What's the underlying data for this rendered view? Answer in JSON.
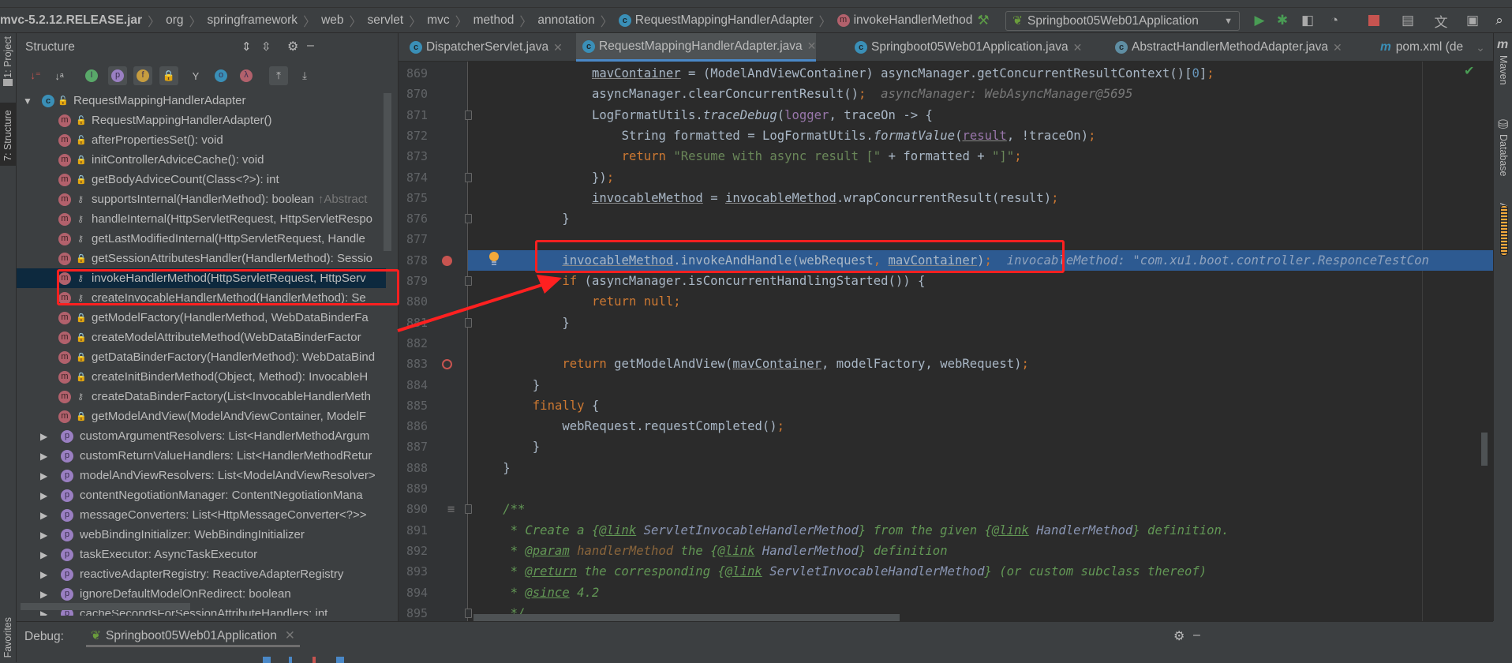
{
  "breadcrumb": {
    "items": [
      "mvc-5.2.12.RELEASE.jar",
      "org",
      "springframework",
      "web",
      "servlet",
      "mvc",
      "method",
      "annotation"
    ],
    "class_item": "RequestMappingHandlerAdapter",
    "method_item": "invokeHandlerMethod"
  },
  "run_config": {
    "label": "Springboot05Web01Application"
  },
  "colors": {
    "accent": "#4a88c7",
    "highlight_line": "#2d5a91",
    "annotation": "#ff2020",
    "selected_row": "#0d293e"
  },
  "left_strip": {
    "project": "1: Project",
    "structure": "7: Structure",
    "favorites": "Favorites"
  },
  "right_strip": {
    "maven": "Maven",
    "database": "Database",
    "ant": "Ant"
  },
  "structure": {
    "title": "Structure",
    "root": "RequestMappingHandlerAdapter",
    "rows": [
      {
        "kind": "m",
        "vis": "public",
        "text": "RequestMappingHandlerAdapter()"
      },
      {
        "kind": "m",
        "vis": "public",
        "text": "afterPropertiesSet(): void"
      },
      {
        "kind": "m",
        "vis": "private",
        "text": "initControllerAdviceCache(): void"
      },
      {
        "kind": "m",
        "vis": "private",
        "text": "getBodyAdviceCount(Class<?>): int"
      },
      {
        "kind": "m",
        "vis": "protected",
        "text": "supportsInternal(HandlerMethod): boolean",
        "hint": "↑Abstract"
      },
      {
        "kind": "m",
        "vis": "protected",
        "text": "handleInternal(HttpServletRequest, HttpServletRespo"
      },
      {
        "kind": "m",
        "vis": "protected",
        "text": "getLastModifiedInternal(HttpServletRequest, Handle"
      },
      {
        "kind": "m",
        "vis": "private",
        "text": "getSessionAttributesHandler(HandlerMethod): Sessio"
      },
      {
        "kind": "m",
        "vis": "protected",
        "text": "invokeHandlerMethod(HttpServletRequest, HttpServ",
        "selected": true
      },
      {
        "kind": "m",
        "vis": "protected",
        "text": "createInvocableHandlerMethod(HandlerMethod): Se"
      },
      {
        "kind": "m",
        "vis": "private",
        "text": "getModelFactory(HandlerMethod, WebDataBinderFa"
      },
      {
        "kind": "m",
        "vis": "private",
        "text": "createModelAttributeMethod(WebDataBinderFactor"
      },
      {
        "kind": "m",
        "vis": "private",
        "text": "getDataBinderFactory(HandlerMethod): WebDataBind"
      },
      {
        "kind": "m",
        "vis": "private",
        "text": "createInitBinderMethod(Object, Method): InvocableH"
      },
      {
        "kind": "m",
        "vis": "protected",
        "text": "createDataBinderFactory(List<InvocableHandlerMeth"
      },
      {
        "kind": "m",
        "vis": "private",
        "text": "getModelAndView(ModelAndViewContainer, ModelF"
      },
      {
        "kind": "p",
        "text": "customArgumentResolvers: List<HandlerMethodArgum"
      },
      {
        "kind": "p",
        "text": "customReturnValueHandlers: List<HandlerMethodRetur"
      },
      {
        "kind": "p",
        "text": "modelAndViewResolvers: List<ModelAndViewResolver>"
      },
      {
        "kind": "p",
        "text": "contentNegotiationManager: ContentNegotiationMana"
      },
      {
        "kind": "p",
        "text": "messageConverters: List<HttpMessageConverter<?>>"
      },
      {
        "kind": "p",
        "text": "webBindingInitializer: WebBindingInitializer"
      },
      {
        "kind": "p",
        "text": "taskExecutor: AsyncTaskExecutor"
      },
      {
        "kind": "p",
        "text": "reactiveAdapterRegistry: ReactiveAdapterRegistry"
      },
      {
        "kind": "p",
        "text": "ignoreDefaultModelOnRedirect: boolean"
      },
      {
        "kind": "p",
        "text": "cacheSecondsForSessionAttributeHandlers: int"
      }
    ]
  },
  "tabs": [
    {
      "label": "DispatcherServlet.java",
      "icon": "class"
    },
    {
      "label": "RequestMappingHandlerAdapter.java",
      "icon": "class",
      "active": true
    },
    {
      "label": "Springboot05Web01Application.java",
      "icon": "spring-class"
    },
    {
      "label": "AbstractHandlerMethodAdapter.java",
      "icon": "abstract-class"
    },
    {
      "label": "pom.xml (de",
      "icon": "maven"
    }
  ],
  "editor": {
    "lines": [
      {
        "n": "869",
        "indent": 20,
        "tokens": [
          [
            "mavContainer",
            "ul"
          ],
          [
            " = (ModelAndViewContainer) asyncManager.getConcurrentResultContext()[",
            ""
          ],
          [
            "0",
            "num"
          ],
          [
            "]",
            ""
          ],
          [
            ";",
            "kw"
          ]
        ]
      },
      {
        "n": "870",
        "indent": 20,
        "tokens": [
          [
            "asyncManager.clearConcurrentResult()",
            ""
          ],
          [
            ";",
            "kw"
          ],
          [
            "  asyncManager: WebAsyncManager@5695",
            "hint"
          ]
        ]
      },
      {
        "n": "871",
        "indent": 20,
        "fold": true,
        "tokens": [
          [
            "LogFormatUtils.",
            ""
          ],
          [
            "traceDebug",
            "it"
          ],
          [
            "(",
            ""
          ],
          [
            "logger",
            "fld"
          ],
          [
            ", traceOn -> {",
            ""
          ]
        ]
      },
      {
        "n": "872",
        "indent": 24,
        "tokens": [
          [
            "String formatted = LogFormatUtils.",
            ""
          ],
          [
            "formatValue",
            "it"
          ],
          [
            "(",
            ""
          ],
          [
            "result",
            "ul fld"
          ],
          [
            ", !traceOn)",
            ""
          ],
          [
            ";",
            "kw"
          ]
        ]
      },
      {
        "n": "873",
        "indent": 24,
        "tokens": [
          [
            "return ",
            "kw"
          ],
          [
            "\"Resume with async result [\"",
            "str"
          ],
          [
            " + formatted + ",
            ""
          ],
          [
            "\"]\"",
            "str"
          ],
          [
            ";",
            "kw"
          ]
        ]
      },
      {
        "n": "874",
        "indent": 20,
        "fold": true,
        "tokens": [
          [
            "})",
            ""
          ],
          [
            ";",
            "kw"
          ]
        ]
      },
      {
        "n": "875",
        "indent": 20,
        "tokens": [
          [
            "invocableMethod",
            "ul"
          ],
          [
            " = ",
            ""
          ],
          [
            "invocableMethod",
            "ul"
          ],
          [
            ".wrapConcurrentResult(result)",
            ""
          ],
          [
            ";",
            "kw"
          ]
        ]
      },
      {
        "n": "876",
        "indent": 16,
        "fold": true,
        "tokens": [
          [
            "}",
            ""
          ]
        ]
      },
      {
        "n": "877",
        "indent": 0,
        "tokens": []
      },
      {
        "n": "878",
        "indent": 16,
        "highlight": true,
        "breakpoint": "hit",
        "tokens": [
          [
            "invocableMethod",
            "ul"
          ],
          [
            ".invokeAndHandle(webRequest",
            ""
          ],
          [
            ",",
            "kw"
          ],
          [
            " ",
            ""
          ],
          [
            "mavContainer",
            "ul"
          ],
          [
            ")",
            ""
          ],
          [
            ";",
            "kw"
          ],
          [
            "  invocableMethod: \"com.xu1.boot.controller.ResponceTestCon",
            "hint"
          ]
        ]
      },
      {
        "n": "879",
        "indent": 16,
        "fold": true,
        "tokens": [
          [
            "if",
            "kw"
          ],
          [
            " (asyncManager.isConcurrentHandlingStarted()) {",
            ""
          ]
        ]
      },
      {
        "n": "880",
        "indent": 20,
        "tokens": [
          [
            "return null",
            "kw"
          ],
          [
            ";",
            "kw"
          ]
        ]
      },
      {
        "n": "881",
        "indent": 16,
        "fold": true,
        "tokens": [
          [
            "}",
            ""
          ]
        ]
      },
      {
        "n": "882",
        "indent": 0,
        "tokens": []
      },
      {
        "n": "883",
        "indent": 16,
        "breakpoint": "line",
        "tokens": [
          [
            "return ",
            "kw"
          ],
          [
            "getModelAndView(",
            ""
          ],
          [
            "mavContainer",
            "ul"
          ],
          [
            ", modelFactory, webRequest)",
            ""
          ],
          [
            ";",
            "kw"
          ]
        ]
      },
      {
        "n": "884",
        "indent": 12,
        "tokens": [
          [
            "}",
            ""
          ]
        ]
      },
      {
        "n": "885",
        "indent": 12,
        "tokens": [
          [
            "finally",
            "kw"
          ],
          [
            " {",
            ""
          ]
        ]
      },
      {
        "n": "886",
        "indent": 16,
        "tokens": [
          [
            "webRequest.requestCompleted()",
            ""
          ],
          [
            ";",
            "kw"
          ]
        ]
      },
      {
        "n": "887",
        "indent": 12,
        "tokens": [
          [
            "}",
            ""
          ]
        ]
      },
      {
        "n": "888",
        "indent": 8,
        "tokens": [
          [
            "}",
            ""
          ]
        ]
      },
      {
        "n": "889",
        "indent": 0,
        "tokens": []
      },
      {
        "n": "890",
        "indent": 8,
        "fold": true,
        "doc": true,
        "tokens": [
          [
            "/**",
            "doc"
          ]
        ]
      },
      {
        "n": "891",
        "indent": 9,
        "tokens": [
          [
            "* Create a {",
            "doc"
          ],
          [
            "@link",
            "dtag"
          ],
          [
            " ",
            ""
          ],
          [
            "ServletInvocableHandlerMethod",
            "dref"
          ],
          [
            "} from the given {",
            "doc"
          ],
          [
            "@link",
            "dtag"
          ],
          [
            " ",
            ""
          ],
          [
            "HandlerMethod",
            "dref"
          ],
          [
            "} definition.",
            "doc"
          ]
        ]
      },
      {
        "n": "892",
        "indent": 9,
        "tokens": [
          [
            "* ",
            "doc"
          ],
          [
            "@param",
            "dtag"
          ],
          [
            " ",
            ""
          ],
          [
            "handlerMethod",
            "dparam"
          ],
          [
            " the {",
            "doc"
          ],
          [
            "@link",
            "dtag"
          ],
          [
            " ",
            ""
          ],
          [
            "HandlerMethod",
            "dref"
          ],
          [
            "} definition",
            "doc"
          ]
        ]
      },
      {
        "n": "893",
        "indent": 9,
        "tokens": [
          [
            "* ",
            "doc"
          ],
          [
            "@return",
            "dtag"
          ],
          [
            " the corresponding {",
            "doc"
          ],
          [
            "@link",
            "dtag"
          ],
          [
            " ",
            ""
          ],
          [
            "ServletInvocableHandlerMethod",
            "dref"
          ],
          [
            "} (or custom subclass thereof)",
            "doc"
          ]
        ]
      },
      {
        "n": "894",
        "indent": 9,
        "tokens": [
          [
            "* ",
            "doc"
          ],
          [
            "@since",
            "dtag"
          ],
          [
            " 4.2",
            "doc"
          ]
        ]
      },
      {
        "n": "895",
        "indent": 9,
        "fold": true,
        "tokens": [
          [
            "*/",
            "doc"
          ]
        ]
      }
    ]
  },
  "debug": {
    "label": "Debug:",
    "session": "Springboot05Web01Application"
  }
}
